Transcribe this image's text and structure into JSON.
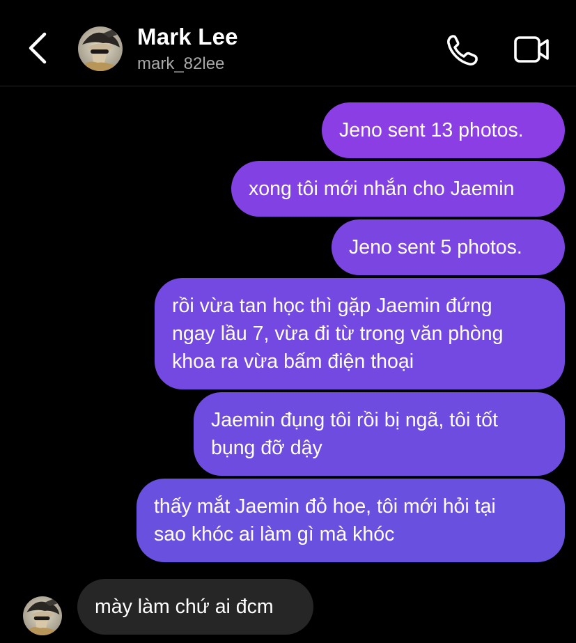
{
  "header": {
    "name": "Mark Lee",
    "username": "mark_82lee",
    "back_icon": "chevron-left-icon",
    "call_icon": "phone-icon",
    "video_icon": "video-camera-icon"
  },
  "colors": {
    "background": "#000000",
    "sent_bubble_top": "#8a3ee4",
    "sent_bubble_bottom": "#6a50df",
    "received_bubble": "#262626",
    "secondary_text": "#a8a8a8"
  },
  "messages": [
    {
      "from": "me",
      "text": "Jeno sent 13 photos."
    },
    {
      "from": "me",
      "text": "xong tôi mới nhắn cho Jaemin"
    },
    {
      "from": "me",
      "text": "Jeno sent 5 photos."
    },
    {
      "from": "me",
      "text": "rồi vừa tan học thì gặp Jaemin đứng\nngay lầu 7, vừa đi từ trong văn phòng\nkhoa ra vừa bấm điện thoại"
    },
    {
      "from": "me",
      "text": "Jaemin đụng tôi rồi bị ngã, tôi tốt\nbụng đỡ dậy"
    },
    {
      "from": "me",
      "text": "thấy mắt Jaemin đỏ hoe, tôi mới hỏi tại\nsao khóc ai làm gì mà khóc"
    },
    {
      "from": "them",
      "text": "mày làm chứ ai đcm"
    }
  ]
}
